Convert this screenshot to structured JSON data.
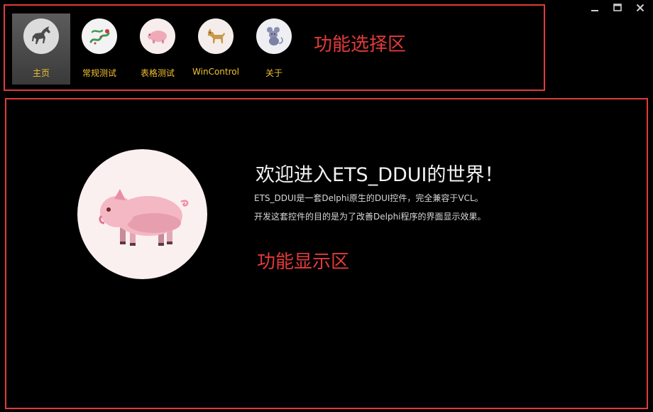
{
  "window": {
    "controls": [
      {
        "name": "minimize-button",
        "icon": "minimize-icon"
      },
      {
        "name": "maximize-button",
        "icon": "maximize-icon"
      },
      {
        "name": "close-button",
        "icon": "close-icon",
        "label": "X"
      }
    ]
  },
  "nav": {
    "zone_label": "功能选择区",
    "active_index": 0,
    "items": [
      {
        "label": "主页",
        "icon": "horse-icon"
      },
      {
        "label": "常规测试",
        "icon": "dragon-icon"
      },
      {
        "label": "表格测试",
        "icon": "pig-icon"
      },
      {
        "label": "WinControl",
        "icon": "dog-icon"
      },
      {
        "label": "关于",
        "icon": "mouse-icon"
      }
    ]
  },
  "main": {
    "hero_icon": "pig-icon",
    "title": "欢迎进入ETS_DDUI的世界！",
    "line1": "ETS_DDUI是一套Delphi原生的DUI控件，完全兼容于VCL。",
    "line2": "开发这套控件的目的是为了改善Delphi程序的界面显示效果。",
    "zone_label": "功能显示区"
  },
  "colors": {
    "background": "#000000",
    "frame_red": "#e33a3a",
    "nav_label": "#f2c230",
    "active_bg": "#4a4a4a",
    "text_light": "#f2f2f2"
  }
}
